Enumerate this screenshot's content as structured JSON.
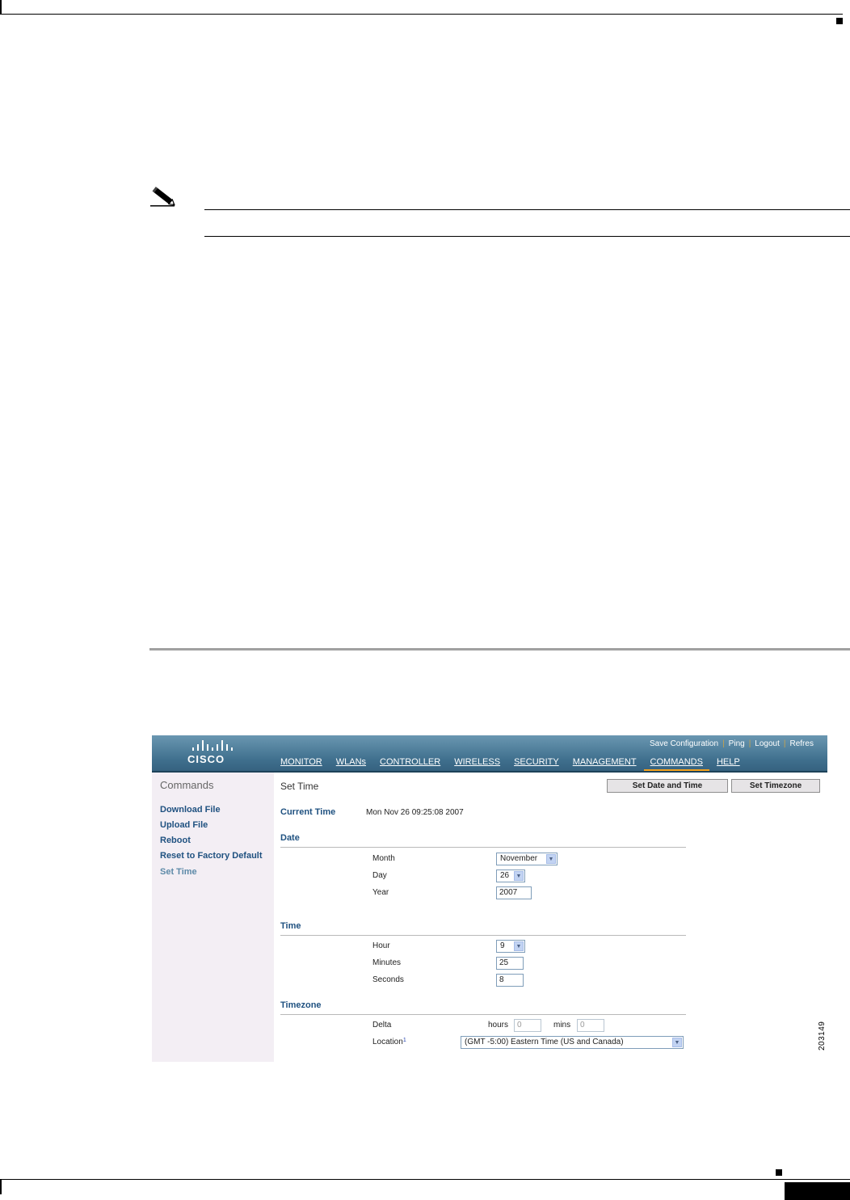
{
  "figure_id": "203149",
  "screen": {
    "header": {
      "logo_text": "CISCO",
      "util_links": [
        "Save Configuration",
        "Ping",
        "Logout",
        "Refres"
      ],
      "nav": [
        "MONITOR",
        "WLANs",
        "CONTROLLER",
        "WIRELESS",
        "SECURITY",
        "MANAGEMENT",
        "COMMANDS",
        "HELP"
      ],
      "active_nav": "COMMANDS"
    },
    "sidebar": {
      "title": "Commands",
      "items": [
        "Download File",
        "Upload File",
        "Reboot",
        "Reset to Factory Default",
        "Set Time"
      ],
      "selected": "Set Time"
    },
    "main": {
      "title": "Set Time",
      "buttons": {
        "set_date_time": "Set Date and Time",
        "set_timezone": "Set Timezone"
      },
      "current_time_label": "Current Time",
      "current_time_value": "Mon Nov 26 09:25:08 2007",
      "date": {
        "heading": "Date",
        "month_label": "Month",
        "month_value": "November",
        "day_label": "Day",
        "day_value": "26",
        "year_label": "Year",
        "year_value": "2007"
      },
      "time": {
        "heading": "Time",
        "hour_label": "Hour",
        "hour_value": "9",
        "minutes_label": "Minutes",
        "minutes_value": "25",
        "seconds_label": "Seconds",
        "seconds_value": "8"
      },
      "timezone": {
        "heading": "Timezone",
        "delta_label": "Delta",
        "hours_label": "hours",
        "hours_value": "0",
        "mins_label": "mins",
        "mins_value": "0",
        "location_label": "Location",
        "location_footnote": "1",
        "location_value": "(GMT -5:00) Eastern Time (US and Canada)"
      }
    }
  }
}
